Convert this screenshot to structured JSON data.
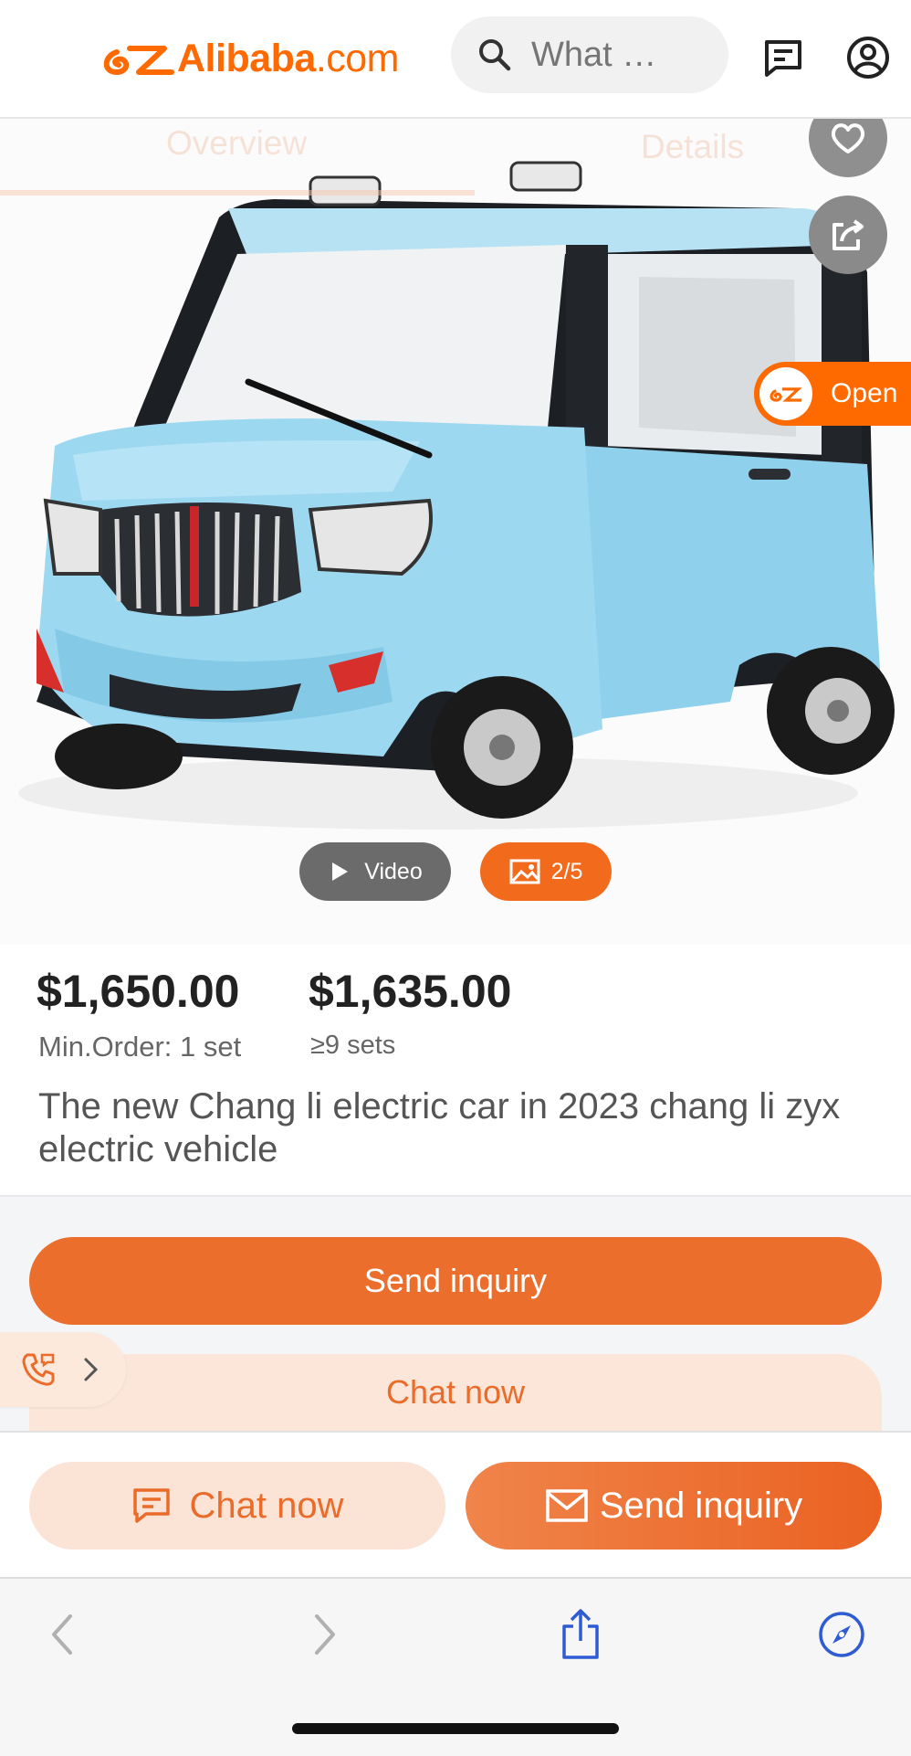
{
  "header": {
    "logo_brand": "Alibaba",
    "logo_domain": ".com",
    "search_placeholder": "What …"
  },
  "hero": {
    "tabs": [
      {
        "label": "Overview"
      },
      {
        "label": "Details"
      }
    ],
    "open_label": "Open",
    "video_label": "Video",
    "gallery_counter": "2/5"
  },
  "pricing": {
    "tiers": [
      {
        "price": "$1,650.00",
        "condition": "Min.Order: 1 set"
      },
      {
        "price": "$1,635.00",
        "condition": "≥9 sets"
      }
    ]
  },
  "product": {
    "title": "The new Chang li electric car in 2023 chang li zyx electric vehicle"
  },
  "actions": {
    "send_inquiry": "Send inquiry",
    "chat_now": "Chat now"
  },
  "sticky_bar": {
    "chat_now": "Chat now",
    "send_inquiry": "Send inquiry"
  },
  "colors": {
    "brand": "#ff6a00",
    "accent": "#eb6e2d",
    "accent_light": "#fbe6d9",
    "safari_blue": "#2f5bd3"
  },
  "icons": [
    "back-icon",
    "search-icon",
    "message-icon",
    "account-icon",
    "heart-icon",
    "share-icon",
    "play-icon",
    "image-icon",
    "phone-icon",
    "chevron-right-icon",
    "chat-bubble-icon",
    "mail-icon",
    "browser-back-icon",
    "browser-forward-icon",
    "browser-share-icon",
    "compass-icon"
  ]
}
